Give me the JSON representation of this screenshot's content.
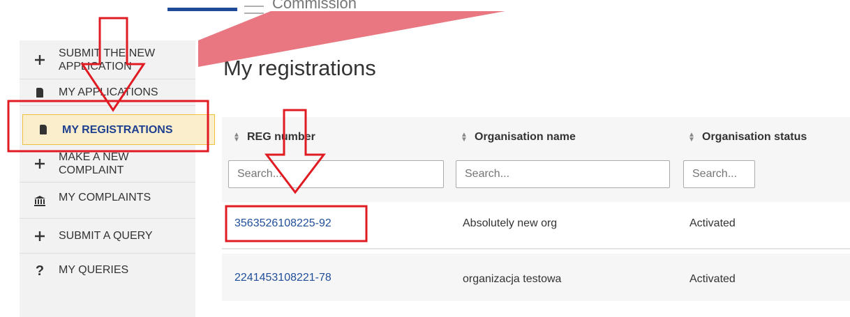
{
  "header": {
    "logo_text": "Commission"
  },
  "sidebar": {
    "items": [
      {
        "label_line1": "SUBMIT THE NEW",
        "label_line2": "APPLICATION",
        "icon": "plus-icon"
      },
      {
        "label": "MY APPLICATIONS",
        "icon": "document-icon"
      },
      {
        "label": "MY REGISTRATIONS",
        "icon": "document-icon",
        "active": true
      },
      {
        "label_line1": "MAKE A NEW",
        "label_line2": "COMPLAINT",
        "icon": "plus-icon"
      },
      {
        "label": "MY COMPLAINTS",
        "icon": "bank-icon"
      },
      {
        "label": "SUBMIT A QUERY",
        "icon": "plus-icon"
      },
      {
        "label": "MY QUERIES",
        "icon": "question-icon"
      }
    ]
  },
  "main": {
    "title": "My registrations",
    "columns": [
      "REG number",
      "Organisation name",
      "Organisation status"
    ],
    "search_placeholder": "Search...",
    "rows": [
      {
        "reg": "3563526108225-92",
        "org": "Absolutely new org",
        "status": "Activated"
      },
      {
        "reg": "2241453108221-78",
        "org": "organizacja testowa",
        "status": "Activated"
      }
    ]
  },
  "colors": {
    "accent_red": "#e01b22",
    "link_blue": "#1f4d9a",
    "active_bg": "#fbeecd"
  }
}
